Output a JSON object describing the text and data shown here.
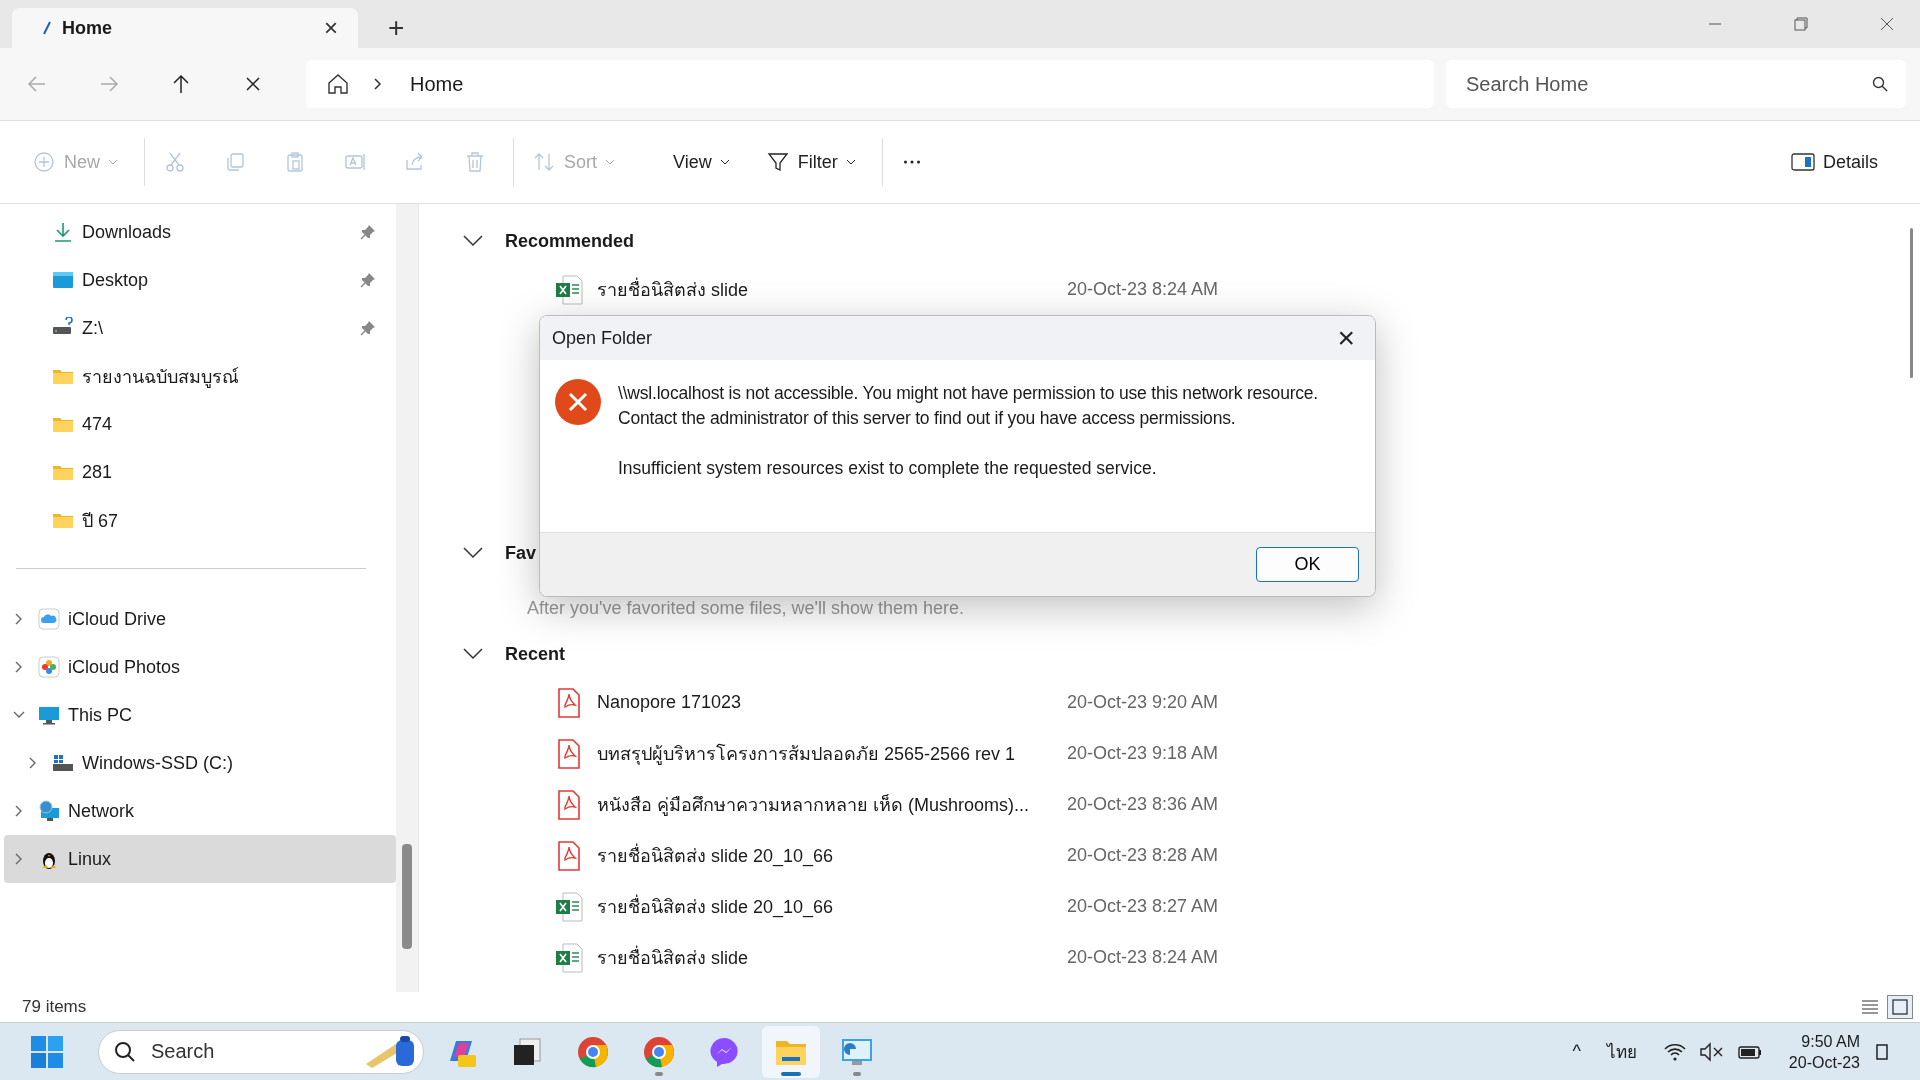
{
  "tabs": [
    {
      "label": "Home",
      "selected": true,
      "close": "×"
    }
  ],
  "new_tab": "+",
  "window_controls": [
    {
      "kind": "minimize"
    },
    {
      "kind": "restore"
    },
    {
      "kind": "close"
    }
  ],
  "nav": [
    {
      "kind": "back",
      "disabled": true
    },
    {
      "kind": "forward",
      "disabled": true
    },
    {
      "kind": "up",
      "disabled": false
    },
    {
      "kind": "stop",
      "disabled": false
    }
  ],
  "address": {
    "crumbs": [
      "Home"
    ]
  },
  "search": {
    "placeholder": "Search Home"
  },
  "toolbar": [
    {
      "kind": "new",
      "label": "New",
      "disabled": true,
      "dropdown": true
    },
    {
      "kind": "cut",
      "disabled": true
    },
    {
      "kind": "copy",
      "disabled": true
    },
    {
      "kind": "paste",
      "disabled": true
    },
    {
      "kind": "rename",
      "disabled": true
    },
    {
      "kind": "share",
      "disabled": true
    },
    {
      "kind": "delete",
      "disabled": true
    },
    {
      "kind": "sort",
      "label": "Sort",
      "disabled": true,
      "dropdown": true
    },
    {
      "kind": "view",
      "label": "View",
      "disabled": false,
      "dropdown": true
    },
    {
      "kind": "filter",
      "label": "Filter",
      "disabled": false,
      "dropdown": true
    },
    {
      "kind": "more",
      "disabled": false
    }
  ],
  "details_button": {
    "label": "Details"
  },
  "sidebar": {
    "quick": [
      {
        "label": "Downloads",
        "kind": "downloads",
        "pinned": true,
        "selected": false
      },
      {
        "label": "Desktop",
        "kind": "desktop",
        "pinned": true,
        "selected": false
      },
      {
        "label": "Z:\\",
        "kind": "drive",
        "pinned": true,
        "selected": false
      },
      {
        "label": "รายงานฉบับสมบูรณ์",
        "kind": "folder",
        "pinned": false,
        "selected": false
      },
      {
        "label": "474",
        "kind": "folder",
        "pinned": false,
        "selected": false
      },
      {
        "label": "281",
        "kind": "folder",
        "pinned": false,
        "selected": false
      },
      {
        "label": "ปี 67",
        "kind": "folder",
        "pinned": false,
        "selected": false
      }
    ],
    "tree": [
      {
        "label": "iCloud Drive",
        "kind": "cloud",
        "expanded": false,
        "selected": false
      },
      {
        "label": "iCloud Photos",
        "kind": "photos",
        "expanded": false,
        "selected": false
      },
      {
        "label": "This PC",
        "kind": "pc",
        "expanded": true,
        "selected": false,
        "children": [
          {
            "label": "Windows-SSD (C:)",
            "kind": "ssd",
            "expanded": false,
            "selected": false
          }
        ]
      },
      {
        "label": "Network",
        "kind": "network",
        "expanded": false,
        "selected": false
      },
      {
        "label": "Linux",
        "kind": "linux",
        "expanded": false,
        "selected": true
      }
    ]
  },
  "sections": [
    {
      "title": "Recommended",
      "expanded": true,
      "files": [
        {
          "name": "รายชื่อนิสิตส่ง slide",
          "date": "20-Oct-23 8:24 AM",
          "kind": "excel"
        }
      ]
    },
    {
      "title": "Fav",
      "expanded": true,
      "note": "After you've favorited some files, we'll show them here."
    },
    {
      "title": "Recent",
      "expanded": true,
      "files": [
        {
          "name": "Nanopore 171023",
          "date": "20-Oct-23 9:20 AM",
          "kind": "pdf"
        },
        {
          "name": "บทสรุปผู้บริหารโครงการส้มปลอดภัย 2565-2566 rev 1",
          "date": "20-Oct-23 9:18 AM",
          "kind": "pdf"
        },
        {
          "name": "หนังสือ คู่มือศึกษาความหลากหลาย เห็ด (Mushrooms)...",
          "date": "20-Oct-23 8:36 AM",
          "kind": "pdf"
        },
        {
          "name": "รายชื่อนิสิตส่ง slide 20_10_66",
          "date": "20-Oct-23 8:28 AM",
          "kind": "pdf"
        },
        {
          "name": "รายชื่อนิสิตส่ง slide 20_10_66",
          "date": "20-Oct-23 8:27 AM",
          "kind": "excel"
        },
        {
          "name": "รายชื่อนิสิตส่ง slide",
          "date": "20-Oct-23 8:24 AM",
          "kind": "excel"
        }
      ]
    }
  ],
  "status": {
    "count": "79 items",
    "views": [
      {
        "kind": "details",
        "selected": false
      },
      {
        "kind": "tiles",
        "selected": true
      }
    ]
  },
  "dialog": {
    "title": "Open Folder",
    "close": "×",
    "lines": [
      "\\\\wsl.localhost is not accessible. You might not have permission to use this network resource.",
      "Contact the administrator of this server to find out if you have access permissions."
    ],
    "detail": "Insufficient system resources exist to complete the requested service.",
    "button": "OK"
  },
  "taskbar": {
    "search": {
      "placeholder": "Search"
    },
    "apps": [
      {
        "kind": "copilot",
        "running": false,
        "selected": false
      },
      {
        "kind": "window",
        "running": false,
        "selected": false
      },
      {
        "kind": "chrome",
        "running": false,
        "selected": false
      },
      {
        "kind": "chrome",
        "running": true,
        "selected": false
      },
      {
        "kind": "messenger",
        "running": false,
        "selected": false
      },
      {
        "kind": "explorer",
        "running": true,
        "selected": true
      },
      {
        "kind": "monitor",
        "running": true,
        "selected": false
      }
    ],
    "tray_caret": "^",
    "language": "ไทย",
    "time": "9:50 AM",
    "date": "20-Oct-23"
  }
}
